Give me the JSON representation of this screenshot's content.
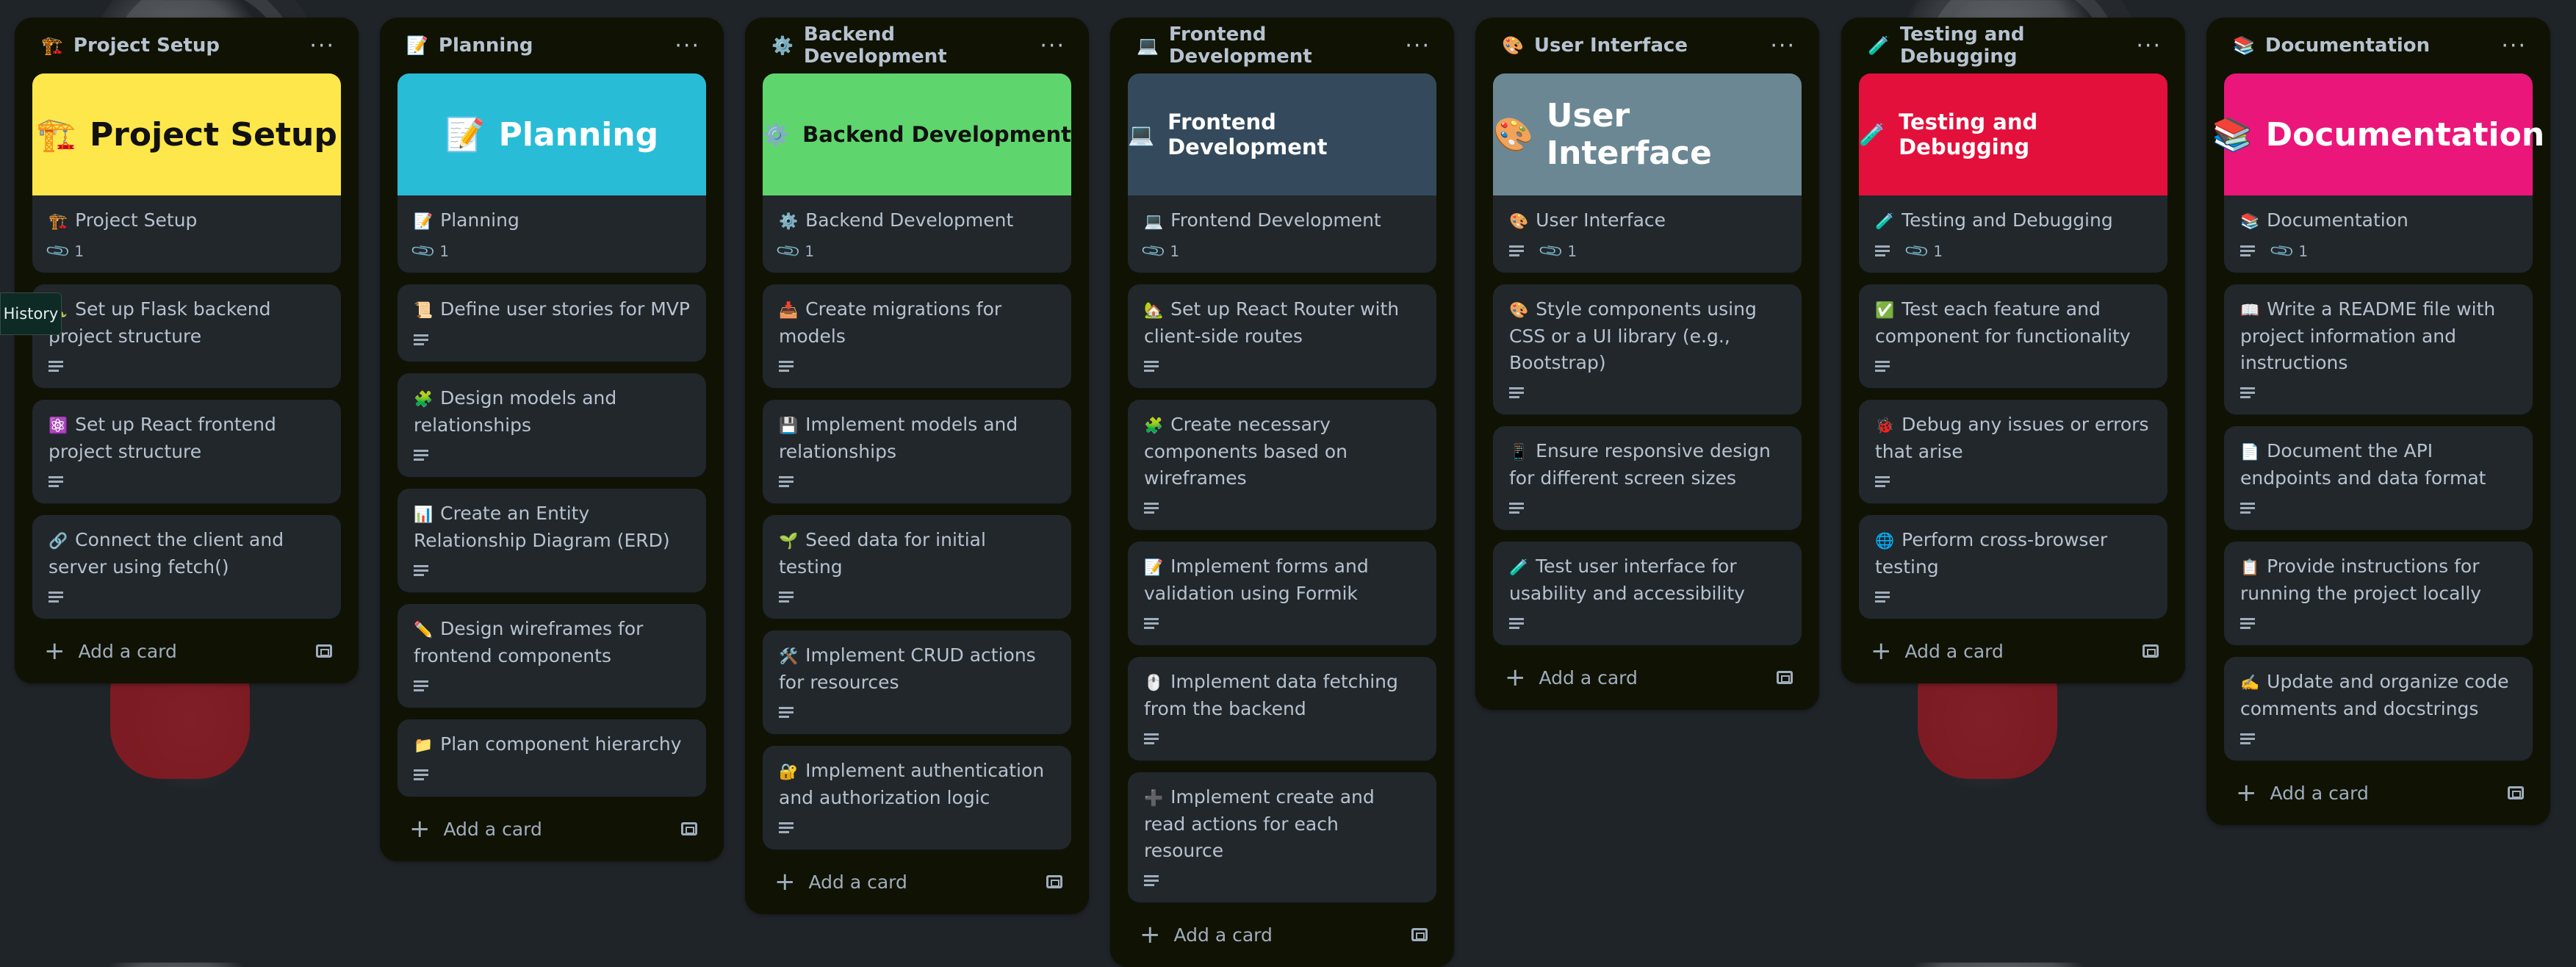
{
  "tooltip": "History",
  "lists": [
    {
      "title": "Project Setup",
      "emoji": "🏗️",
      "cover": {
        "bg": "#fee74a",
        "text_color": "#111111",
        "size": "big",
        "emoji": "🏗️",
        "text": "Project Setup"
      },
      "cards": [
        {
          "emoji": "🏗️",
          "text": "Project Setup",
          "desc": false,
          "attach": "1"
        },
        {
          "emoji": "🐍",
          "text": "Set up Flask backend project structure",
          "desc": true
        },
        {
          "emoji": "⚛️",
          "text": "Set up React frontend project structure",
          "desc": true
        },
        {
          "emoji": "🔗",
          "text": "Connect the client and server using fetch()",
          "desc": true
        }
      ],
      "add_label": "Add a card"
    },
    {
      "title": "Planning",
      "emoji": "📝",
      "cover": {
        "bg": "#29bcd7",
        "text_color": "#ffffff",
        "size": "big",
        "emoji": "📝",
        "text": "Planning"
      },
      "cards": [
        {
          "emoji": "📝",
          "text": "Planning",
          "desc": false,
          "attach": "1"
        },
        {
          "emoji": "📜",
          "text": "Define user stories for MVP",
          "desc": true
        },
        {
          "emoji": "🧩",
          "text": "Design models and relationships",
          "desc": true
        },
        {
          "emoji": "📊",
          "text": "Create an Entity Relationship Diagram (ERD)",
          "desc": true
        },
        {
          "emoji": "✏️",
          "text": "Design wireframes for frontend components",
          "desc": true
        },
        {
          "emoji": "📁",
          "text": "Plan component hierarchy",
          "desc": true
        }
      ],
      "add_label": "Add a card"
    },
    {
      "title": "Backend Development",
      "emoji": "⚙️",
      "cover": {
        "bg": "#5fd66d",
        "text_color": "#111111",
        "size": "mid",
        "emoji": "⚙️",
        "text": "Backend Development"
      },
      "cards": [
        {
          "emoji": "⚙️",
          "text": "Backend Development",
          "desc": false,
          "attach": "1"
        },
        {
          "emoji": "📥",
          "text": "Create migrations for models",
          "desc": true
        },
        {
          "emoji": "💾",
          "text": "Implement models and relationships",
          "desc": true
        },
        {
          "emoji": "🌱",
          "text": "Seed data for initial testing",
          "desc": true
        },
        {
          "emoji": "🛠️",
          "text": "Implement CRUD actions for resources",
          "desc": true
        },
        {
          "emoji": "🔐",
          "text": "Implement authentication and authorization logic",
          "desc": true
        }
      ],
      "add_label": "Add a card"
    },
    {
      "title": "Frontend Development",
      "emoji": "💻",
      "cover": {
        "bg": "#344a5c",
        "text_color": "#ffffff",
        "size": "mid",
        "emoji": "💻",
        "text": "Frontend Development"
      },
      "cards": [
        {
          "emoji": "💻",
          "text": "Frontend Development",
          "desc": false,
          "attach": "1"
        },
        {
          "emoji": "🏡",
          "text": "Set up React Router with client-side routes",
          "desc": true
        },
        {
          "emoji": "🧩",
          "text": "Create necessary components based on wireframes",
          "desc": true
        },
        {
          "emoji": "📝",
          "text": "Implement forms and validation using Formik",
          "desc": true
        },
        {
          "emoji": "🖱️",
          "text": "Implement data fetching from the backend",
          "desc": true
        },
        {
          "emoji": "➕",
          "text": "Implement create and read actions for each resource",
          "desc": true
        }
      ],
      "add_label": "Add a card"
    },
    {
      "title": "User Interface",
      "emoji": "🎨",
      "cover": {
        "bg": "#6b8794",
        "text_color": "#ffffff",
        "size": "big",
        "emoji": "🎨",
        "text": "User Interface"
      },
      "cards": [
        {
          "emoji": "🎨",
          "text": "User Interface",
          "desc": true,
          "attach": "1"
        },
        {
          "emoji": "🎨",
          "text": "Style components using CSS or a UI library (e.g., Bootstrap)",
          "desc": true
        },
        {
          "emoji": "📱",
          "text": "Ensure responsive design for different screen sizes",
          "desc": true
        },
        {
          "emoji": "🧪",
          "text": "Test user interface for usability and accessibility",
          "desc": true
        }
      ],
      "add_label": "Add a card"
    },
    {
      "title": "Testing and Debugging",
      "emoji": "🧪",
      "cover": {
        "bg": "#e2103b",
        "text_color": "#ffffff",
        "size": "mid",
        "emoji": "🧪",
        "text": "Testing and Debugging"
      },
      "cards": [
        {
          "emoji": "🧪",
          "text": "Testing and Debugging",
          "desc": true,
          "attach": "1"
        },
        {
          "emoji": "✅",
          "text": "Test each feature and component for functionality",
          "desc": true
        },
        {
          "emoji": "🐞",
          "text": "Debug any issues or errors that arise",
          "desc": true
        },
        {
          "emoji": "🌐",
          "text": "Perform cross-browser testing",
          "desc": true
        }
      ],
      "add_label": "Add a card"
    },
    {
      "title": "Documentation",
      "emoji": "📚",
      "cover": {
        "bg": "#ea1679",
        "text_color": "#ffffff",
        "size": "big",
        "emoji": "📚",
        "text": "Documentation"
      },
      "cards": [
        {
          "emoji": "📚",
          "text": "Documentation",
          "desc": true,
          "attach": "1"
        },
        {
          "emoji": "📖",
          "text": "Write a README file with project information and instructions",
          "desc": true
        },
        {
          "emoji": "📄",
          "text": "Document the API endpoints and data format",
          "desc": true
        },
        {
          "emoji": "📋",
          "text": "Provide instructions for running the project locally",
          "desc": true
        },
        {
          "emoji": "✍️",
          "text": "Update and organize code comments and docstrings",
          "desc": true
        }
      ],
      "add_label": "Add a card"
    }
  ]
}
